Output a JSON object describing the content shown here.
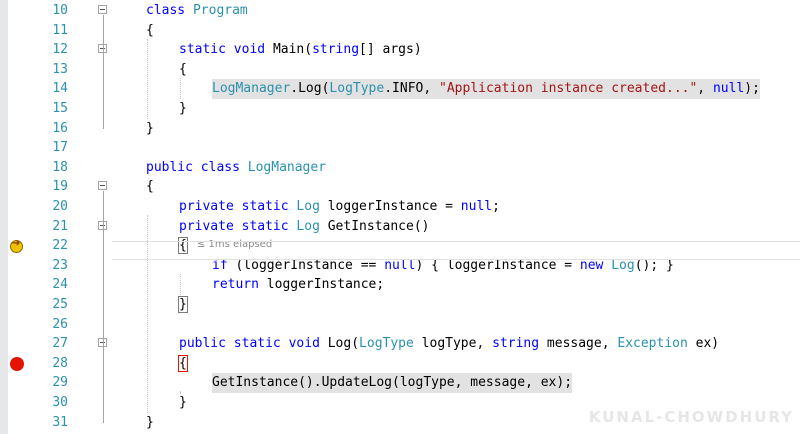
{
  "editor": {
    "lines": [
      {
        "n": "10",
        "parts": [
          [
            "k",
            "class "
          ],
          [
            "t",
            "Program"
          ]
        ]
      },
      {
        "n": "11",
        "parts": [
          [
            "p",
            "{"
          ]
        ]
      },
      {
        "n": "12",
        "parts": [
          [
            "k",
            "static "
          ],
          [
            "k",
            "void "
          ],
          [
            "p",
            "Main("
          ],
          [
            "k",
            "string"
          ],
          [
            "p",
            "[] args)"
          ]
        ]
      },
      {
        "n": "13",
        "parts": [
          [
            "p",
            "{"
          ]
        ]
      },
      {
        "n": "14",
        "parts": [
          [
            "t",
            "LogManager"
          ],
          [
            "p",
            ".Log("
          ],
          [
            "t",
            "LogType"
          ],
          [
            "p",
            ".INFO, "
          ],
          [
            "s",
            "\"Application instance created...\""
          ],
          [
            "p",
            ", "
          ],
          [
            "k",
            "null"
          ],
          [
            "p",
            ");"
          ]
        ],
        "hl": true
      },
      {
        "n": "15",
        "parts": [
          [
            "p",
            "}"
          ]
        ]
      },
      {
        "n": "16",
        "parts": [
          [
            "p",
            "}"
          ]
        ]
      },
      {
        "n": "17",
        "parts": []
      },
      {
        "n": "18",
        "parts": [
          [
            "k",
            "public "
          ],
          [
            "k",
            "class "
          ],
          [
            "t",
            "LogManager"
          ]
        ]
      },
      {
        "n": "19",
        "parts": [
          [
            "p",
            "{"
          ]
        ]
      },
      {
        "n": "20",
        "parts": [
          [
            "k",
            "private "
          ],
          [
            "k",
            "static "
          ],
          [
            "t",
            "Log"
          ],
          [
            "p",
            " loggerInstance = "
          ],
          [
            "k",
            "null"
          ],
          [
            "p",
            ";"
          ]
        ]
      },
      {
        "n": "21",
        "parts": [
          [
            "k",
            "private "
          ],
          [
            "k",
            "static "
          ],
          [
            "t",
            "Log"
          ],
          [
            "p",
            " GetInstance()"
          ]
        ]
      },
      {
        "n": "22",
        "parts": [
          [
            "p",
            "{"
          ]
        ],
        "perftip": "≤ 1ms elapsed"
      },
      {
        "n": "23",
        "parts": [
          [
            "k",
            "if "
          ],
          [
            "p",
            "(loggerInstance == "
          ],
          [
            "k",
            "null"
          ],
          [
            "p",
            ") { loggerInstance = "
          ],
          [
            "k",
            "new "
          ],
          [
            "t",
            "Log"
          ],
          [
            "p",
            "(); }"
          ]
        ]
      },
      {
        "n": "24",
        "parts": [
          [
            "k",
            "return "
          ],
          [
            "p",
            "loggerInstance;"
          ]
        ]
      },
      {
        "n": "25",
        "parts": [
          [
            "p",
            "}"
          ]
        ]
      },
      {
        "n": "26",
        "parts": []
      },
      {
        "n": "27",
        "parts": [
          [
            "k",
            "public "
          ],
          [
            "k",
            "static "
          ],
          [
            "k",
            "void "
          ],
          [
            "p",
            "Log("
          ],
          [
            "t",
            "LogType"
          ],
          [
            "p",
            " logType, "
          ],
          [
            "k",
            "string "
          ],
          [
            "p",
            "message, "
          ],
          [
            "t",
            "Exception"
          ],
          [
            "p",
            " ex)"
          ]
        ]
      },
      {
        "n": "28",
        "parts": [
          [
            "p",
            "{"
          ]
        ]
      },
      {
        "n": "29",
        "parts": [
          [
            "p",
            "GetInstance().UpdateLog(logType, message, ex);"
          ]
        ],
        "hl": true
      },
      {
        "n": "30",
        "parts": [
          [
            "p",
            "}"
          ]
        ]
      },
      {
        "n": "31",
        "parts": [
          [
            "p",
            "}"
          ]
        ]
      }
    ]
  },
  "watermark": "KUNAL-CHOWDHURY",
  "colors": {
    "keyword": "#0000ff",
    "type": "#2b91af",
    "string": "#a31515",
    "breakpoint": "#e51400"
  }
}
